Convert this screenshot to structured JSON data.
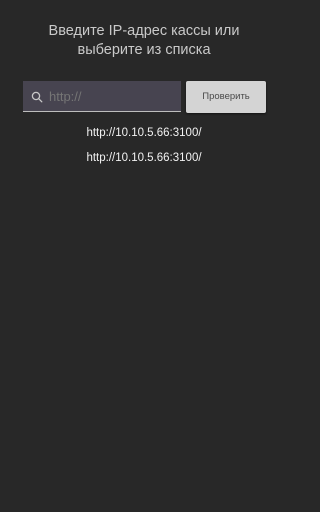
{
  "header": {
    "title": "Введите IP-адрес кассы или\nвыберите из списка"
  },
  "search": {
    "icon": "search-icon",
    "value": "",
    "placeholder": "http://"
  },
  "actions": {
    "check_label": "Проверить"
  },
  "addresses": [
    "http://10.10.5.66:3100/",
    "http://10.10.5.66:3100/"
  ],
  "colors": {
    "background": "#282828",
    "input_background": "#474450",
    "button_background": "#d4d4d4"
  }
}
